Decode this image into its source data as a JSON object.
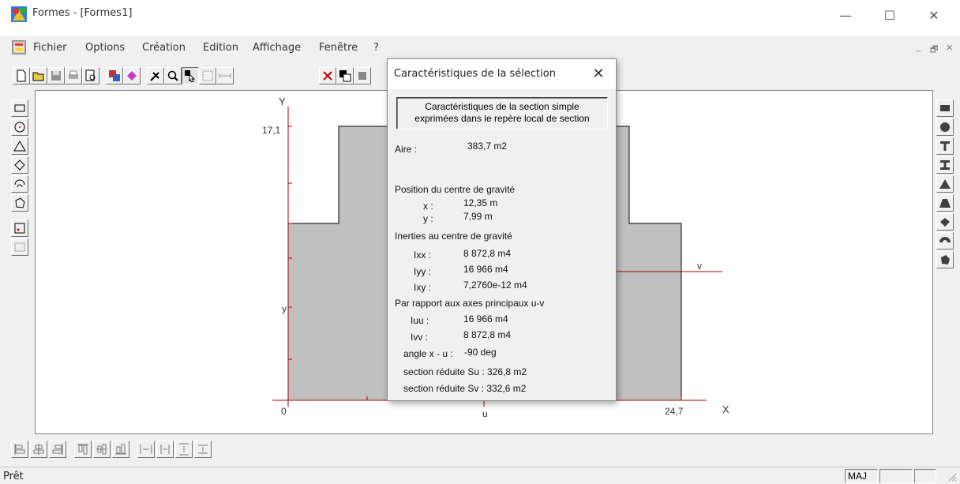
{
  "window": {
    "title": "Formes - [Formes1]",
    "minimize": "—",
    "maximize": "☐",
    "close": "✕"
  },
  "menu": {
    "items": [
      "Fichier",
      "Options",
      "Création",
      "Edition",
      "Affichage",
      "Fenêtre",
      "?"
    ],
    "mdi_min": "_",
    "mdi_restore": "🗗",
    "mdi_close": "✕"
  },
  "canvas": {
    "axis_y_label": "Y",
    "axis_x_label": "X",
    "y_tick_top": "17,1",
    "x_tick_origin": "0",
    "x_tick_right": "24,7",
    "u_label": "u",
    "v_label": "v",
    "y_marker": "y"
  },
  "dialog": {
    "title": "Caractéristiques de la sélection",
    "close": "✕",
    "header_line1": "Caractéristiques de la section simple",
    "header_line2": "exprimées dans le repère local de section",
    "area_label": "Aire :",
    "area_value": "383,7  m2",
    "centroid_title": "Position du centre de gravité",
    "x_label": "x :",
    "x_value": "12,35  m",
    "y_label": "y :",
    "y_value": "7,99  m",
    "inertia_title": "Inerties au centre de gravité",
    "ixx_label": "Ixx :",
    "ixx_value": "8 872,8  m4",
    "iyy_label": "Iyy :",
    "iyy_value": "16 966  m4",
    "ixy_label": "Ixy :",
    "ixy_value": "7,2760e-12  m4",
    "principal_title": "Par rapport aux axes principaux u-v",
    "iuu_label": "Iuu :",
    "iuu_value": "16 966  m4",
    "ivv_label": "Ivv :",
    "ivv_value": "8 872,8  m4",
    "angle_label": "angle x - u :",
    "angle_value": "-90  deg",
    "su_text": "section réduite Su : 326,8  m2",
    "sv_text": "section réduite Sv : 332,6  m2"
  },
  "status": {
    "text": "Prêt",
    "caps": "MAJ"
  },
  "colors": {
    "shape_fill": "#c0c0c0",
    "axis_red": "#b00000",
    "brand_blue": "#1e6fd9"
  }
}
